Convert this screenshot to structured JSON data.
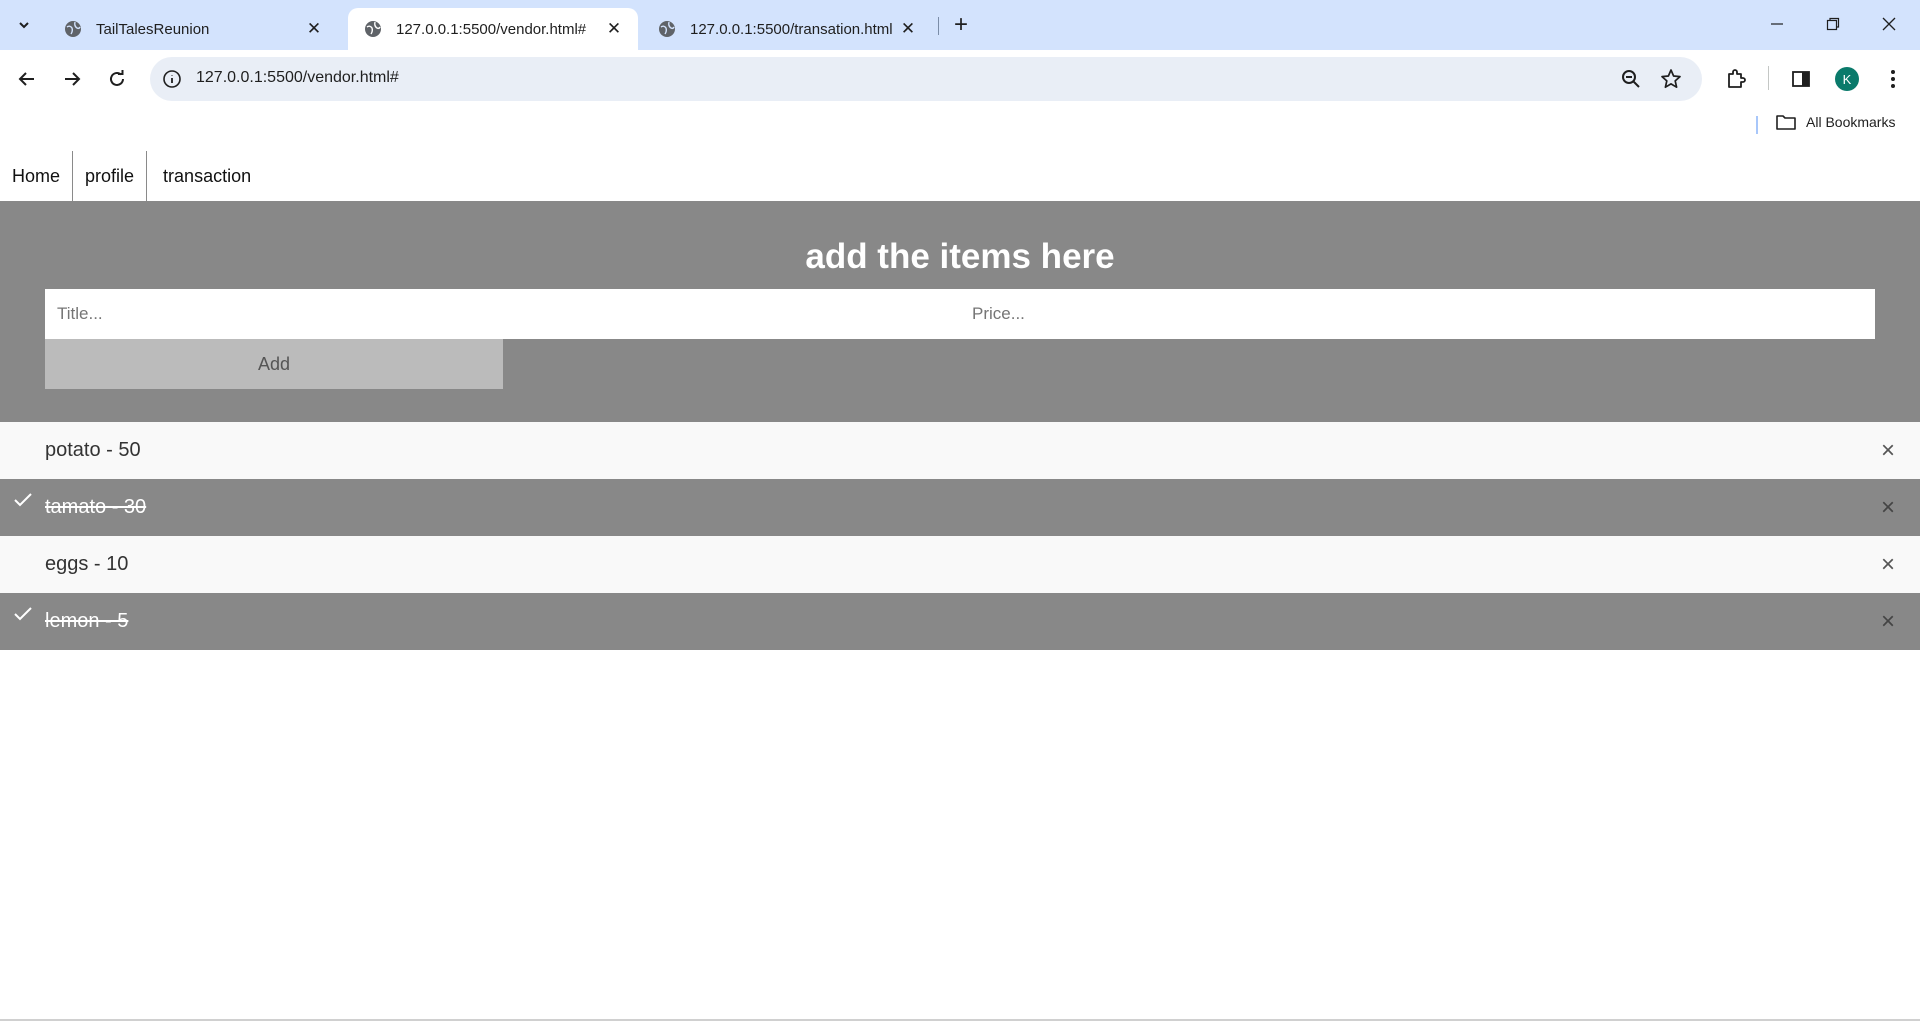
{
  "browser": {
    "tabs": [
      {
        "title": "TailTalesReunion",
        "active": false
      },
      {
        "title": "127.0.0.1:5500/vendor.html#",
        "active": true
      },
      {
        "title": "127.0.0.1:5500/transation.html",
        "active": false
      }
    ],
    "url": "127.0.0.1:5500/vendor.html#",
    "profile_initial": "K",
    "bookmarks_label": "All Bookmarks"
  },
  "nav": {
    "items": [
      {
        "label": "Home"
      },
      {
        "label": "profile"
      },
      {
        "label": "transaction"
      }
    ]
  },
  "form": {
    "heading": "add the items here",
    "title_placeholder": "Title...",
    "price_placeholder": "Price...",
    "add_label": "Add"
  },
  "items": [
    {
      "text": "potato - 50",
      "checked": false,
      "close": "×"
    },
    {
      "text": "tamato - 30",
      "checked": true,
      "close": "×"
    },
    {
      "text": "eggs - 10",
      "checked": false,
      "close": "×"
    },
    {
      "text": "lemon - 5",
      "checked": true,
      "close": "×"
    }
  ]
}
